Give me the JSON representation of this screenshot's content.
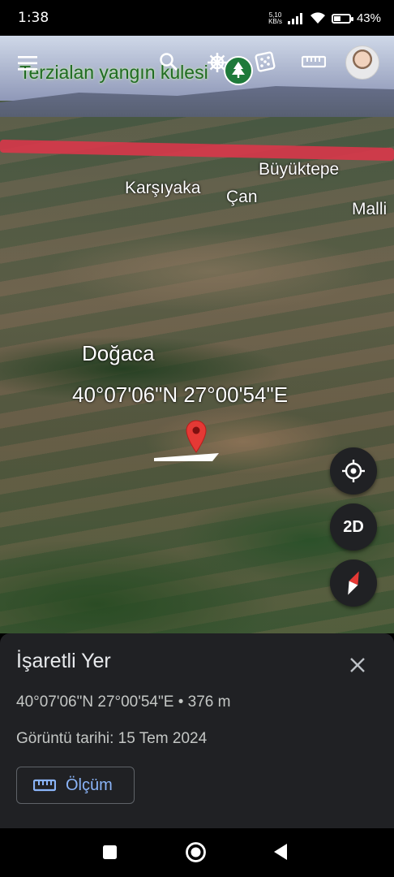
{
  "status": {
    "time": "1:38",
    "net_speed_value": "5,10",
    "net_speed_unit": "KB/s",
    "battery": "43%",
    "battery_level": 0.43
  },
  "map": {
    "layer_title": "Terzialan yangın kulesi",
    "places": {
      "buyuktepe": "Büyüktepe",
      "karsiyaka": "Karşıyaka",
      "can": "Çan",
      "malli": "Malli",
      "dogaca": "Doğaca"
    },
    "marker_coords": "40°07'06\"N 27°00'54\"E",
    "toolbar_icons": [
      "menu-icon",
      "search-icon",
      "voyager-wheel-icon",
      "dice-icon",
      "ruler-icon"
    ],
    "view_mode_label": "2D"
  },
  "sheet": {
    "title": "İşaretli Yer",
    "coords_elevation": "40°07'06\"N 27°00'54\"E • 376 m",
    "imagery_date": "Görüntü tarihi: 15 Tem 2024",
    "measure_label": "Ölçüm"
  },
  "colors": {
    "accent_blue": "#8ab4f8",
    "pin_red": "#e53935",
    "sheet_bg": "#202124",
    "tree_green": "#1e7a3a"
  }
}
